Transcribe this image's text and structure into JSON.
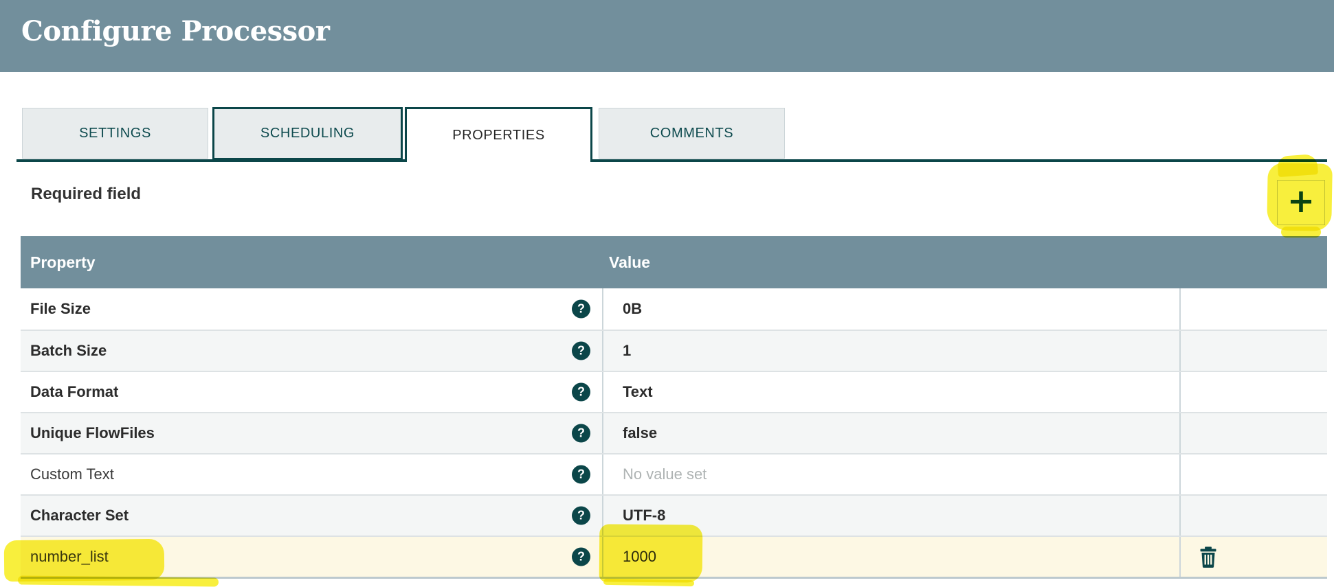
{
  "dialog": {
    "title": "Configure Processor"
  },
  "tabs": [
    {
      "label": "SETTINGS",
      "state": "inactive"
    },
    {
      "label": "SCHEDULING",
      "state": "focused"
    },
    {
      "label": "PROPERTIES",
      "state": "active"
    },
    {
      "label": "COMMENTS",
      "state": "inactive"
    }
  ],
  "properties_panel": {
    "required_field_label": "Required field",
    "add_button": {
      "glyph": "+",
      "icon": "plus-icon"
    },
    "table": {
      "columns": [
        "Property",
        "Value"
      ],
      "help_glyph": "?",
      "rows": [
        {
          "name": "File Size",
          "value": "0B",
          "required": true,
          "value_unset": false,
          "deletable": false,
          "highlighted": false
        },
        {
          "name": "Batch Size",
          "value": "1",
          "required": true,
          "value_unset": false,
          "deletable": false,
          "highlighted": false
        },
        {
          "name": "Data Format",
          "value": "Text",
          "required": true,
          "value_unset": false,
          "deletable": false,
          "highlighted": false
        },
        {
          "name": "Unique FlowFiles",
          "value": "false",
          "required": true,
          "value_unset": false,
          "deletable": false,
          "highlighted": false
        },
        {
          "name": "Custom Text",
          "value": "No value set",
          "required": false,
          "value_unset": true,
          "deletable": false,
          "highlighted": false
        },
        {
          "name": "Character Set",
          "value": "UTF-8",
          "required": true,
          "value_unset": false,
          "deletable": false,
          "highlighted": false
        },
        {
          "name": "number_list",
          "value": "1000",
          "required": false,
          "value_unset": false,
          "deletable": true,
          "highlighted": true
        }
      ]
    }
  },
  "annotations": {
    "highlight_color": "#f7eb12",
    "highlighted_items": [
      "add-property-button",
      "number_list property name",
      "number_list value 1000"
    ]
  },
  "colors": {
    "header_background": "#728f9c",
    "accent_teal": "#0b4649",
    "tab_inactive_background": "#e8eced",
    "row_alt_background": "#f4f6f6",
    "custom_row_background": "#fdf8e4",
    "unset_value_text": "#aeb3b3"
  }
}
